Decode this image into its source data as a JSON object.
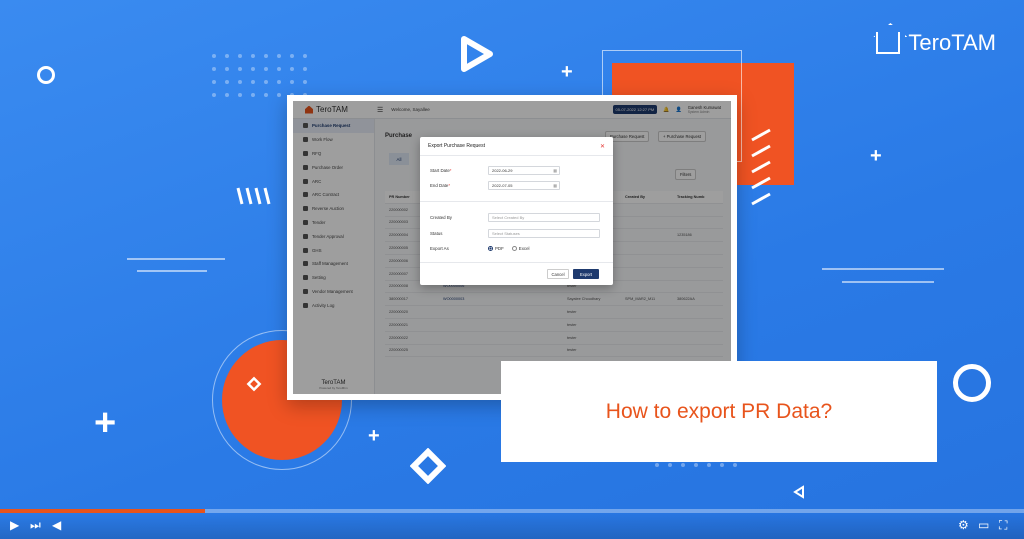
{
  "brand": {
    "name": "TeroTAM"
  },
  "callout": {
    "text": "How to export PR Data?"
  },
  "app": {
    "logo": "TeroTAM",
    "welcome": "Welcome, Sayallee",
    "datetime": "05-07-2022 12:27 PM",
    "user_name": "Ganesh Kumawat",
    "user_role": "System Admin",
    "page_title": "Purchase",
    "tab_all": "All",
    "header_buttons": {
      "purchase_request": "Purchase Request",
      "add_request": "+ Purchase Request",
      "filter": "Filters"
    },
    "sidebar": [
      "Purchase Request",
      "Work Flow",
      "RFQ",
      "Purchase Order",
      "ARC",
      "ARC Contract",
      "Reverse Auction",
      "Tender",
      "Tender Approval",
      "GHS",
      "Staff Management",
      "Setting",
      "Vendor Management",
      "Activity Log"
    ],
    "sidebar_footer": "TeroTAM",
    "sidebar_footer_sub": "Powered by TeroMtm",
    "table": {
      "headers": [
        "PR Number",
        "",
        "Name",
        "Created By",
        "Tracking Numb"
      ],
      "rows": [
        [
          "220000002",
          "",
          "",
          "",
          ""
        ],
        [
          "220000003",
          "",
          "",
          "",
          ""
        ],
        [
          "220000004",
          "",
          "",
          "",
          "1235186"
        ],
        [
          "220000005",
          "",
          "",
          "",
          ""
        ],
        [
          "220000006",
          "",
          "",
          "",
          ""
        ],
        [
          "220000007",
          "",
          "",
          "",
          ""
        ],
        [
          "220000008",
          "WO0000006",
          "tester",
          "",
          ""
        ],
        [
          "380000017",
          "WO0000003",
          "Sayalee Choudhary",
          "SPM_MAR2_M11",
          "380622AA"
        ],
        [
          "220000020",
          "",
          "tester",
          "",
          ""
        ],
        [
          "220000021",
          "",
          "tester",
          "",
          ""
        ],
        [
          "220000022",
          "",
          "tester",
          "",
          ""
        ],
        [
          "220000025",
          "",
          "tester",
          "",
          ""
        ]
      ]
    },
    "modal": {
      "title": "Export Purchase Request",
      "start_label": "Start Date",
      "start_value": "2022-06-29",
      "end_label": "End Date",
      "end_value": "2022-07-05",
      "created_by_label": "Created By",
      "created_by_placeholder": "Select Created By",
      "status_label": "Status",
      "status_placeholder": "Select Statuses",
      "export_as_label": "Export As",
      "opt_pdf": "PDF",
      "opt_excel": "Excel",
      "cancel": "Cancel",
      "export": "Export"
    }
  },
  "player": {
    "progress": 0.2
  },
  "colors": {
    "background": "#2f80ea",
    "accent": "#e8541c",
    "navy": "#1e3a6e"
  }
}
